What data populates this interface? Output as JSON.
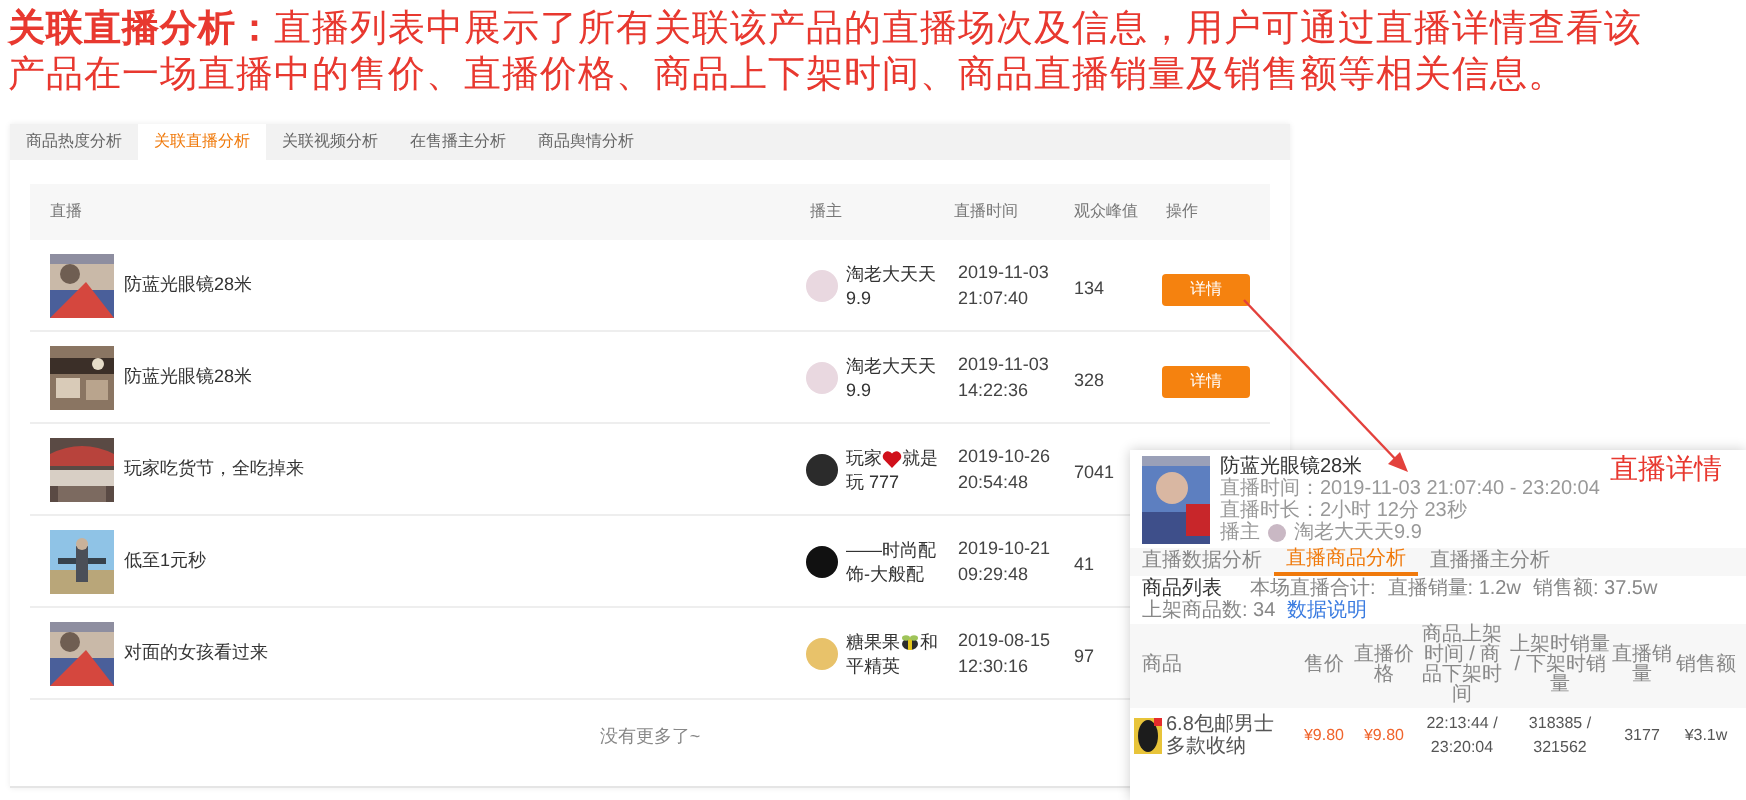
{
  "heading": "**关联直播分析：**直播列表中展示了所有关联该产品的直播场次及信息，用户可通过直播详情查看该产品在一场直播中的售价、直播价格、商品上下架时间、商品直播销量及销售额等相关信息。",
  "tabs": [
    {
      "label": "商品热度分析",
      "selected": false
    },
    {
      "label": "关联直播分析",
      "selected": true
    },
    {
      "label": "关联视频分析",
      "selected": false
    },
    {
      "label": "在售播主分析",
      "selected": false
    },
    {
      "label": "商品舆情分析",
      "selected": false
    }
  ],
  "table": {
    "columns": [
      "直播",
      "播主",
      "直播时间",
      "观众峰值",
      "操作"
    ],
    "rows": [
      {
        "title": "防蓝光眼镜28米",
        "anchor": {
          "name": [
            {
              "text": "淘老大天天9.9"
            }
          ]
        },
        "time": [
          "2019-11-03",
          "21:07:40"
        ],
        "viewers": "134",
        "action": "详情"
      },
      {
        "title": "防蓝光眼镜28米",
        "anchor": {
          "name": [
            {
              "text": "淘老大天天9.9"
            }
          ]
        },
        "time": [
          "2019-11-03",
          "14:22:36"
        ],
        "viewers": "328",
        "action": "详情"
      },
      {
        "title": "玩家吃货节，全吃掉来",
        "anchor": {
          "name": [
            {
              "text": "玩家"
            },
            {
              "kind": "heart"
            },
            {
              "text": "就是玩 777"
            }
          ]
        },
        "time": [
          "2019-10-26",
          "20:54:48"
        ],
        "viewers": "7041"
      },
      {
        "title": "低至1元秒",
        "anchor": {
          "name": [
            {
              "text": "——时尚配饰-大般配"
            }
          ]
        },
        "time": [
          "2019-10-21",
          "09:29:48"
        ],
        "viewers": "41"
      },
      {
        "title": "对面的女孩看过来",
        "anchor": {
          "name": [
            {
              "text": "糖果果"
            },
            {
              "kind": "bee"
            },
            {
              "text": "和平精英"
            }
          ]
        },
        "time": [
          "2019-08-15",
          "12:30:16"
        ],
        "viewers": "97"
      }
    ]
  },
  "footer": "没有更多了~",
  "annotation": {
    "label": "直播详情"
  },
  "detail": {
    "title": "防蓝光眼镜28米",
    "time": "直播时间：2019-11-03 21:07:40 - 23:20:04",
    "duration": "直播时长：2小时 12分 23秒",
    "anchor_label": "播主",
    "anchor": "淘老大天天9.9",
    "tabs": [
      {
        "label": "直播数据分析",
        "selected": false
      },
      {
        "label": "直播商品分析",
        "selected": true
      },
      {
        "label": "直播播主分析",
        "selected": false
      }
    ],
    "list_title": "商品列表",
    "stats": [
      "本场直播合计:",
      "直播销量: 1.2w",
      "销售额: 37.5w",
      "上架商品数: 34"
    ],
    "note": "数据说明",
    "columns": [
      "商品",
      "售价",
      "直播价格",
      "商品上架时间 / 商品下架时间",
      "上架时销量 / 下架时销量",
      "直播销量",
      "销售额"
    ],
    "rows": [
      {
        "product": "6.8包邮男士多款收纳",
        "price": "¥9.80",
        "live_price": "¥9.80",
        "times": "22:13:44 / 23:20:04",
        "sales": "318385 / 321562",
        "live_sales": "3177",
        "revenue": "¥3.1w"
      }
    ]
  }
}
